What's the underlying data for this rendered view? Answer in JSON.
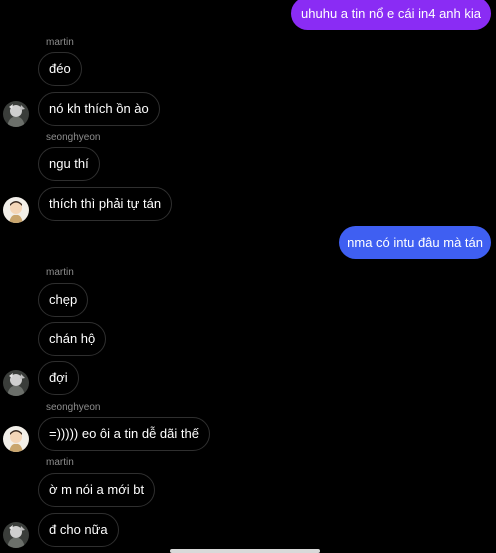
{
  "colors": {
    "background": "#000000",
    "outgoing_gradient_top": "#8a2cf4",
    "outgoing_gradient_bottom": "#3d5af1",
    "incoming_border": "#2f2f2f",
    "sender_name": "#8e8e8e"
  },
  "messages": [
    {
      "direction": "outgoing",
      "text": "uhuhu a tin nổ e cái in4 anh kia"
    },
    {
      "direction": "incoming",
      "sender": "martin",
      "text": "đéo"
    },
    {
      "direction": "incoming",
      "sender": "martin",
      "text": "nó kh thích ồn ào"
    },
    {
      "direction": "incoming",
      "sender": "seonghyeon",
      "text": "ngu thí"
    },
    {
      "direction": "incoming",
      "sender": "seonghyeon",
      "text": "thích thì phải tự tán"
    },
    {
      "direction": "outgoing",
      "text": "nma có intu đâu mà tán"
    },
    {
      "direction": "incoming",
      "sender": "martin",
      "text": "chẹp"
    },
    {
      "direction": "incoming",
      "sender": "martin",
      "text": "chán hộ"
    },
    {
      "direction": "incoming",
      "sender": "martin",
      "text": "đợi"
    },
    {
      "direction": "incoming",
      "sender": "seonghyeon",
      "text": "=))))) eo ôi a tin dễ dãi thế"
    },
    {
      "direction": "incoming",
      "sender": "martin",
      "text": "ờ m nói a mới bt"
    },
    {
      "direction": "incoming",
      "sender": "martin",
      "text": "đ cho nữa"
    }
  ],
  "sender_labels": [
    "martin",
    "seonghyeon",
    "martin",
    "seonghyeon",
    "martin"
  ],
  "avatars": [
    "martin-avatar",
    "seonghyeon-avatar"
  ]
}
